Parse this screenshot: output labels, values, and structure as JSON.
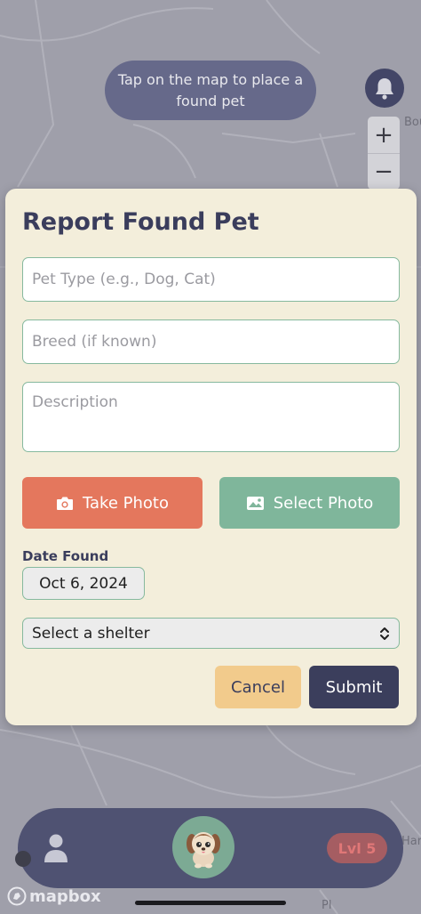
{
  "map": {
    "hint": "Tap on the map to place a found pet",
    "zoom_in": "+",
    "zoom_out": "−",
    "street_label_1": "Bou",
    "street_label_2": "Har",
    "street_label_3": "Pl",
    "attribution": "mapbox"
  },
  "modal": {
    "title": "Report Found Pet",
    "pet_type_placeholder": "Pet Type (e.g., Dog, Cat)",
    "breed_placeholder": "Breed (if known)",
    "description_placeholder": "Description",
    "take_photo_label": "Take Photo",
    "select_photo_label": "Select Photo",
    "date_label": "Date Found",
    "date_value": "Oct 6, 2024",
    "shelter_selected": "Select a shelter",
    "cancel_label": "Cancel",
    "submit_label": "Submit"
  },
  "bottom_bar": {
    "level": "Lvl 5"
  },
  "icons": {
    "bell": "bell-icon",
    "camera": "camera-icon",
    "image": "image-icon",
    "profile": "person-icon",
    "chevron": "up-down-chevron-icon"
  },
  "colors": {
    "accent_dark": "#3b3e5c",
    "take_photo": "#e4775d",
    "select_photo": "#7fb69b",
    "cancel": "#f2cb8c",
    "field_border": "#86b99e",
    "modal_bg": "#f3eedb"
  }
}
